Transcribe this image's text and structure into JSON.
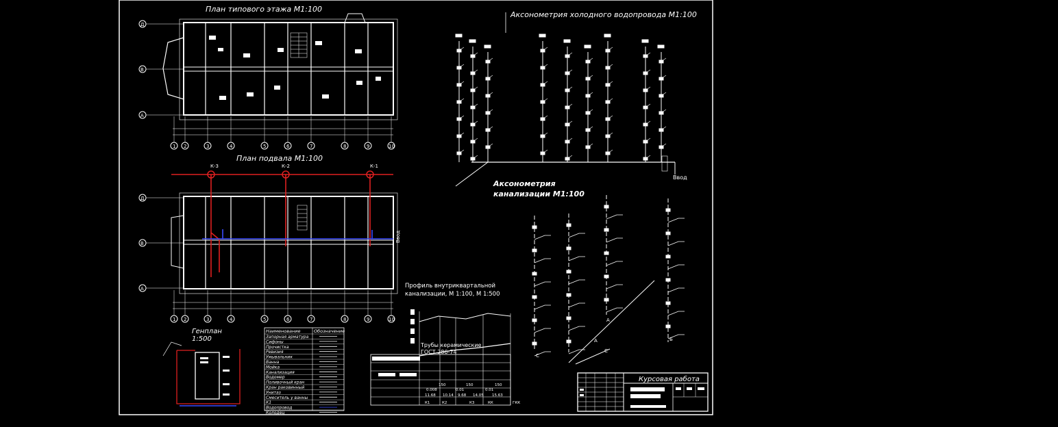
{
  "sheet": {
    "stamp_title": "Курсовая работа"
  },
  "plan_floor": {
    "title": "План типового этажа М1:100",
    "row_axes": [
      "Д",
      "В",
      "А"
    ],
    "col_axes": [
      "1",
      "2",
      "3",
      "4",
      "5",
      "6",
      "7",
      "8",
      "9",
      "10"
    ]
  },
  "plan_basement": {
    "title": "План подвала М1:100",
    "row_axes": [
      "Д",
      "В",
      "А"
    ],
    "col_axes": [
      "1",
      "2",
      "3",
      "4",
      "5",
      "6",
      "7",
      "8",
      "9",
      "10"
    ],
    "wells": [
      "К-3",
      "К-2",
      "К-1"
    ],
    "inlet_label": "Ввод"
  },
  "axon_water": {
    "title": "Аксонометрия холодного водопровода М1:100",
    "inlet_label": "Ввод"
  },
  "axon_sewer": {
    "title_line1": "Аксонометрия",
    "title_line2": "канализации М1:100",
    "riser_labels": [
      "А",
      "А",
      "Б",
      "С",
      "С"
    ]
  },
  "genplan": {
    "title": "Генплан",
    "scale": "1:500"
  },
  "legend": {
    "headers": [
      "Наименование",
      "Обозначение"
    ],
    "items": [
      "Запорная арматура",
      "Сифоны",
      "Прочистка",
      "Ревизия",
      "Умывальник",
      "Ванна",
      "Мойка",
      "Канализация",
      "Водомер",
      "Поливочный кран",
      "Кран раковинный",
      "Унитаз",
      "Смеситель у ванны",
      "К1",
      "Водопровод",
      "Колодец"
    ]
  },
  "profile": {
    "title_line1": "Профиль внутриквартальной",
    "title_line2": "канализации, М 1:100, М 1:500",
    "pipe_note_line1": "Трубы керамические",
    "pipe_note_line2": "ГОСТ 286-74",
    "diameters": [
      "150",
      "150",
      "150"
    ],
    "slopes": [
      "0.008",
      "0.01",
      "0.01"
    ],
    "marks": [
      "11.68",
      "10.14",
      "9.68",
      "14.05",
      "15.63"
    ],
    "wells": [
      "К1",
      "К2",
      "К3",
      "КК"
    ],
    "end_label": "ГКК"
  }
}
